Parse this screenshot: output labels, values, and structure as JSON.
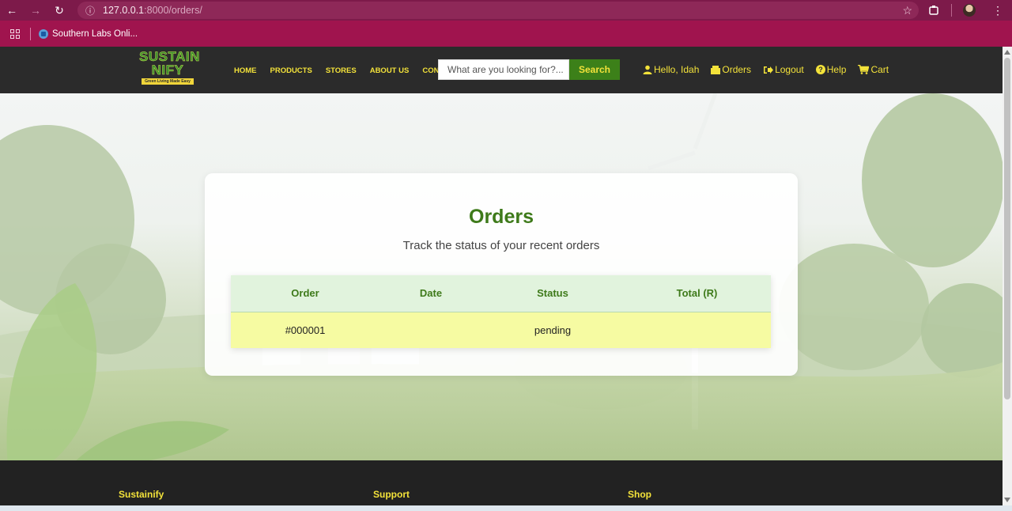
{
  "browser": {
    "url_host": "127.0.0.1",
    "url_port_path": ":8000/orders/",
    "bookmark": "Southern Labs Onli..."
  },
  "header": {
    "logo_line1": "SUSTAIN",
    "logo_line2": "NIFY",
    "logo_tagline": "Green Living Made Easy",
    "nav": [
      "HOME",
      "PRODUCTS",
      "STORES",
      "ABOUT US",
      "CONTACT"
    ],
    "search_placeholder": "What are you looking for?...",
    "search_button": "Search",
    "greeting": "Hello, Idah",
    "orders_link": "Orders",
    "logout_link": "Logout",
    "help_link": "Help",
    "cart_link": "Cart"
  },
  "main": {
    "title": "Orders",
    "subtitle": "Track the status of your recent orders",
    "table": {
      "columns": [
        "Order",
        "Date",
        "Status",
        "Total (R)"
      ],
      "rows": [
        [
          "#000001",
          "",
          "pending",
          ""
        ]
      ]
    }
  },
  "footer": {
    "columns": [
      "Sustainify",
      "Support",
      "Shop"
    ]
  },
  "colors": {
    "accent_yellow": "#f3e23a",
    "brand_green": "#3e7a1a",
    "header_bg": "#2b2b2b"
  }
}
